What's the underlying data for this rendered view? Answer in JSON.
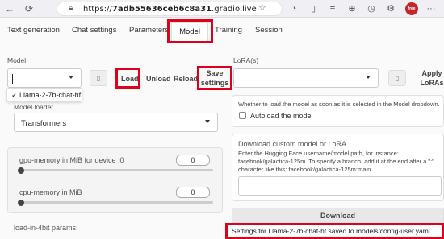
{
  "browser": {
    "url_prefix": "https://",
    "url_host": "7adb55636ceb6c8a31",
    "url_suffix": ".gradio.live"
  },
  "tabs": [
    "Text generation",
    "Chat settings",
    "Parameters",
    "Model",
    "Training",
    "Session"
  ],
  "active_tab": "Model",
  "model": {
    "label": "Model",
    "load_label": "Load",
    "unload_label": "Unload",
    "reload_label": "Reload",
    "save_settings_label": "Save settings",
    "dropdown_option": "✓ Llama-2-7b-chat-hf",
    "loader_label": "Model loader",
    "loader_value": "Transformers"
  },
  "memory": {
    "gpu_label": "gpu-memory in MiB for device :0",
    "gpu_value": "0",
    "cpu_label": "cpu-memory in MiB",
    "cpu_value": "0",
    "load4bit_label": "load-in-4bit params:"
  },
  "lora": {
    "label": "LoRA(s)",
    "apply_label": "Apply LoRAs"
  },
  "autoload": {
    "desc": "Whether to load the model as soon as it is selected in the Model dropdown.",
    "checkbox_label": "Autoload the model"
  },
  "download": {
    "title": "Download custom model or LoRA",
    "desc_line1": "Enter the Hugging Face username/model path, for instance:",
    "desc_line2": "facebook/galactica-125m. To specify a branch, add it at the end after a \":\"",
    "desc_line3": "character like this: facebook/galactica-125m:main",
    "button_label": "Download"
  },
  "status_message": "Settings for Llama-2-7b-chat-hf saved to models/config-user.yaml"
}
